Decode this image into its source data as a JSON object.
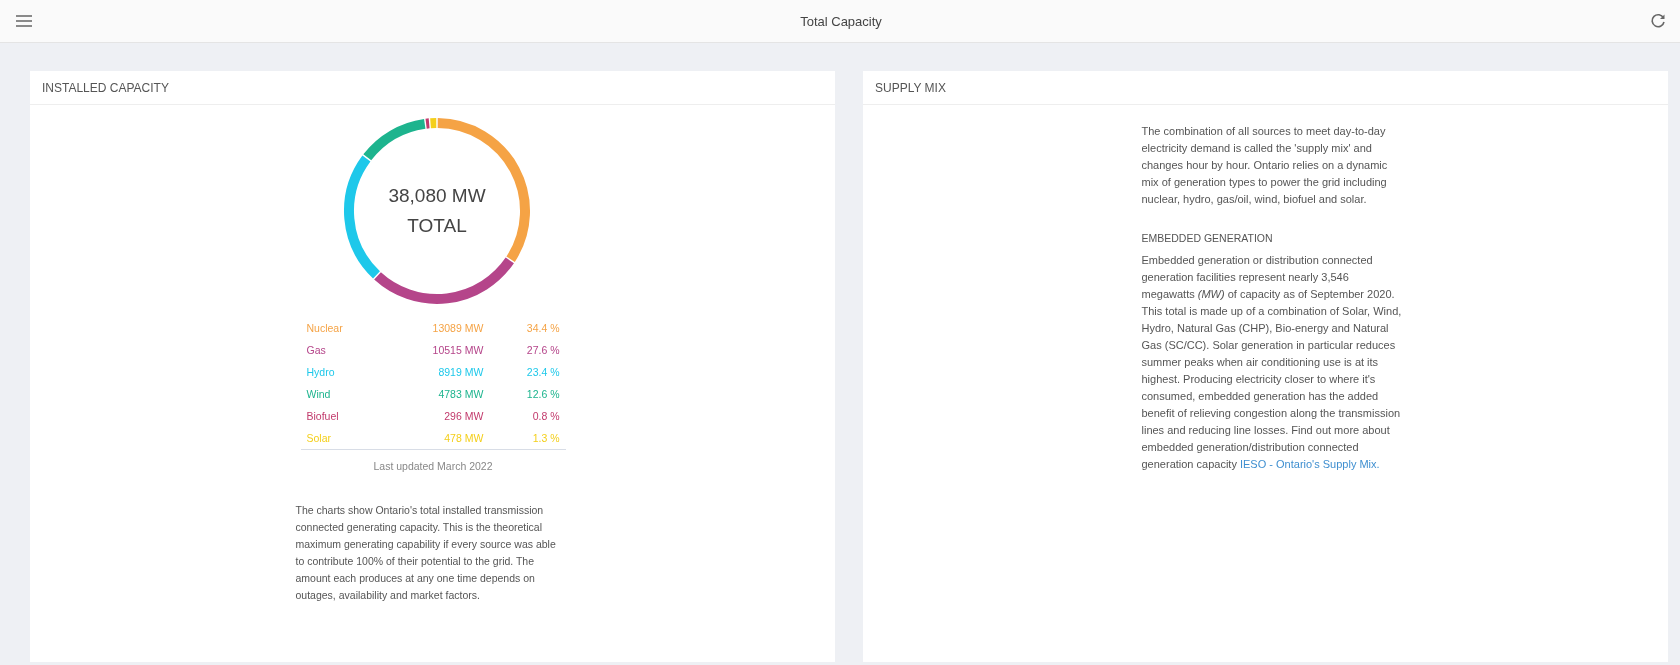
{
  "header": {
    "title": "Total Capacity"
  },
  "installed_capacity": {
    "title": "INSTALLED CAPACITY",
    "center_value": "38,080 MW",
    "center_label": "TOTAL",
    "legend": [
      {
        "name": "Nuclear",
        "mw": "13089 MW",
        "percent": "34.4 %",
        "color": "#f5a345"
      },
      {
        "name": "Gas",
        "mw": "10515 MW",
        "percent": "27.6 %",
        "color": "#b5458a"
      },
      {
        "name": "Hydro",
        "mw": "8919 MW",
        "percent": "23.4 %",
        "color": "#1ec8ea"
      },
      {
        "name": "Wind",
        "mw": "4783 MW",
        "percent": "12.6 %",
        "color": "#1db48e"
      },
      {
        "name": "Biofuel",
        "mw": "296 MW",
        "percent": "0.8 %",
        "color": "#c23a6c"
      },
      {
        "name": "Solar",
        "mw": "478 MW",
        "percent": "1.3 %",
        "color": "#f4cf1a"
      }
    ],
    "updated": "Last updated March 2022",
    "description": "The charts show Ontario's total installed transmission connected generating capacity. This is the theoretical maximum generating capability if every source was able to contribute 100% of their potential to the grid. The amount each produces at any one time depends on outages, availability and market factors."
  },
  "supply_mix": {
    "title": "SUPPLY MIX",
    "intro": "The combination of all sources to meet day-to-day electricity demand is called the 'supply mix' and changes hour by hour. Ontario relies on a dynamic mix of generation types to power the grid including nuclear, hydro, gas/oil, wind, biofuel and solar.",
    "subheading": "EMBEDDED GENERATION",
    "body": "Embedded generation or distribution connected generation facilities represent nearly 3,546 megawatts *(MW)* of capacity as of September 2020. This total is made up of a combination of Solar, Wind, Hydro, Natural Gas (CHP), Bio-energy and Natural Gas (SC/CC). Solar generation in particular reduces summer peaks when air conditioning use is at its highest. Producing electricity closer to where it's consumed, embedded generation has the added benefit of relieving congestion along the transmission lines and reducing line losses. Find out more about embedded generation/distribution connected generation capacity",
    "link": "IESO - Ontario's Supply Mix."
  }
}
